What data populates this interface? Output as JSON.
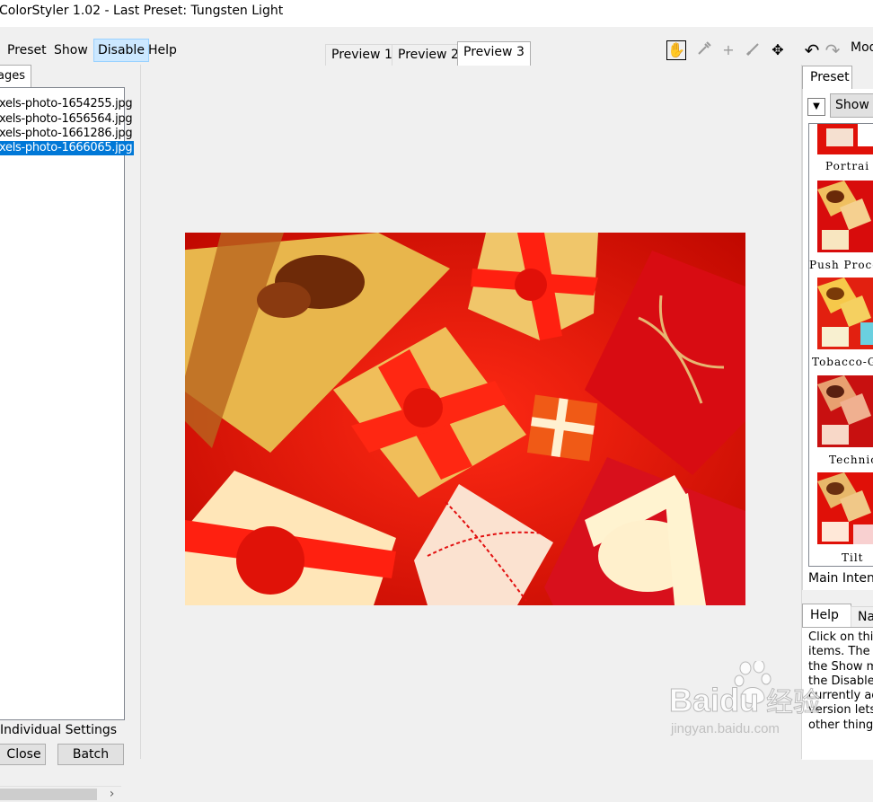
{
  "window": {
    "title": "ColorStyler 1.02 - Last Preset: Tungsten Light"
  },
  "menu": [
    {
      "label": "Preset",
      "active": false
    },
    {
      "label": "Show",
      "active": false
    },
    {
      "label": "Disable",
      "active": true
    },
    {
      "label": "Help",
      "active": false
    }
  ],
  "left_panel": {
    "tab_label": "ages",
    "files": [
      {
        "name": "xels-photo-1654255.jpg",
        "selected": false
      },
      {
        "name": "xels-photo-1656564.jpg",
        "selected": false
      },
      {
        "name": "xels-photo-1661286.jpg",
        "selected": false
      },
      {
        "name": "xels-photo-1666065.jpg",
        "selected": true
      }
    ],
    "scroll_right_glyph": "›",
    "individual_settings_label": "Individual Settings",
    "close_button": "Close",
    "batch_button": "Batch"
  },
  "preview_tabs": [
    {
      "label": "Preview 1",
      "active": false
    },
    {
      "label": "Preview 2",
      "active": false
    },
    {
      "label": "Preview 3",
      "active": true
    }
  ],
  "toolbar": {
    "tools": [
      {
        "icon": "hand-icon",
        "glyph": "✋"
      },
      {
        "icon": "eyedropper-icon",
        "glyph": "⁄"
      },
      {
        "icon": "crosshair-icon",
        "glyph": "+"
      },
      {
        "icon": "brush-icon",
        "glyph": "∕"
      },
      {
        "icon": "move-arrows-icon",
        "glyph": "✥"
      },
      {
        "icon": "undo-icon",
        "glyph": "↶"
      },
      {
        "icon": "redo-icon",
        "glyph": "↷"
      }
    ],
    "mode_label": "Mod"
  },
  "right_panel": {
    "tab_label": "Preset",
    "show_all_label": "Show A",
    "dropdown_glyph": "▼",
    "presets": [
      {
        "label": "Portrai"
      },
      {
        "label": "Push Proce"
      },
      {
        "label": "Tobacco-G"
      },
      {
        "label": "Technic"
      },
      {
        "label": "Tilt"
      }
    ],
    "main_intensity_label": "Main Intensi"
  },
  "help_panel": {
    "tabs": [
      {
        "label": "Help"
      },
      {
        "label": "Na"
      }
    ],
    "lines": [
      "Click on this",
      "items. The P",
      "the Show me",
      "the Disable m",
      "currently act",
      "version lets y",
      "other things."
    ]
  },
  "watermark": {
    "brand": "Baidu",
    "brand_cn": "经验",
    "url": "jingyan.baidu.com"
  }
}
